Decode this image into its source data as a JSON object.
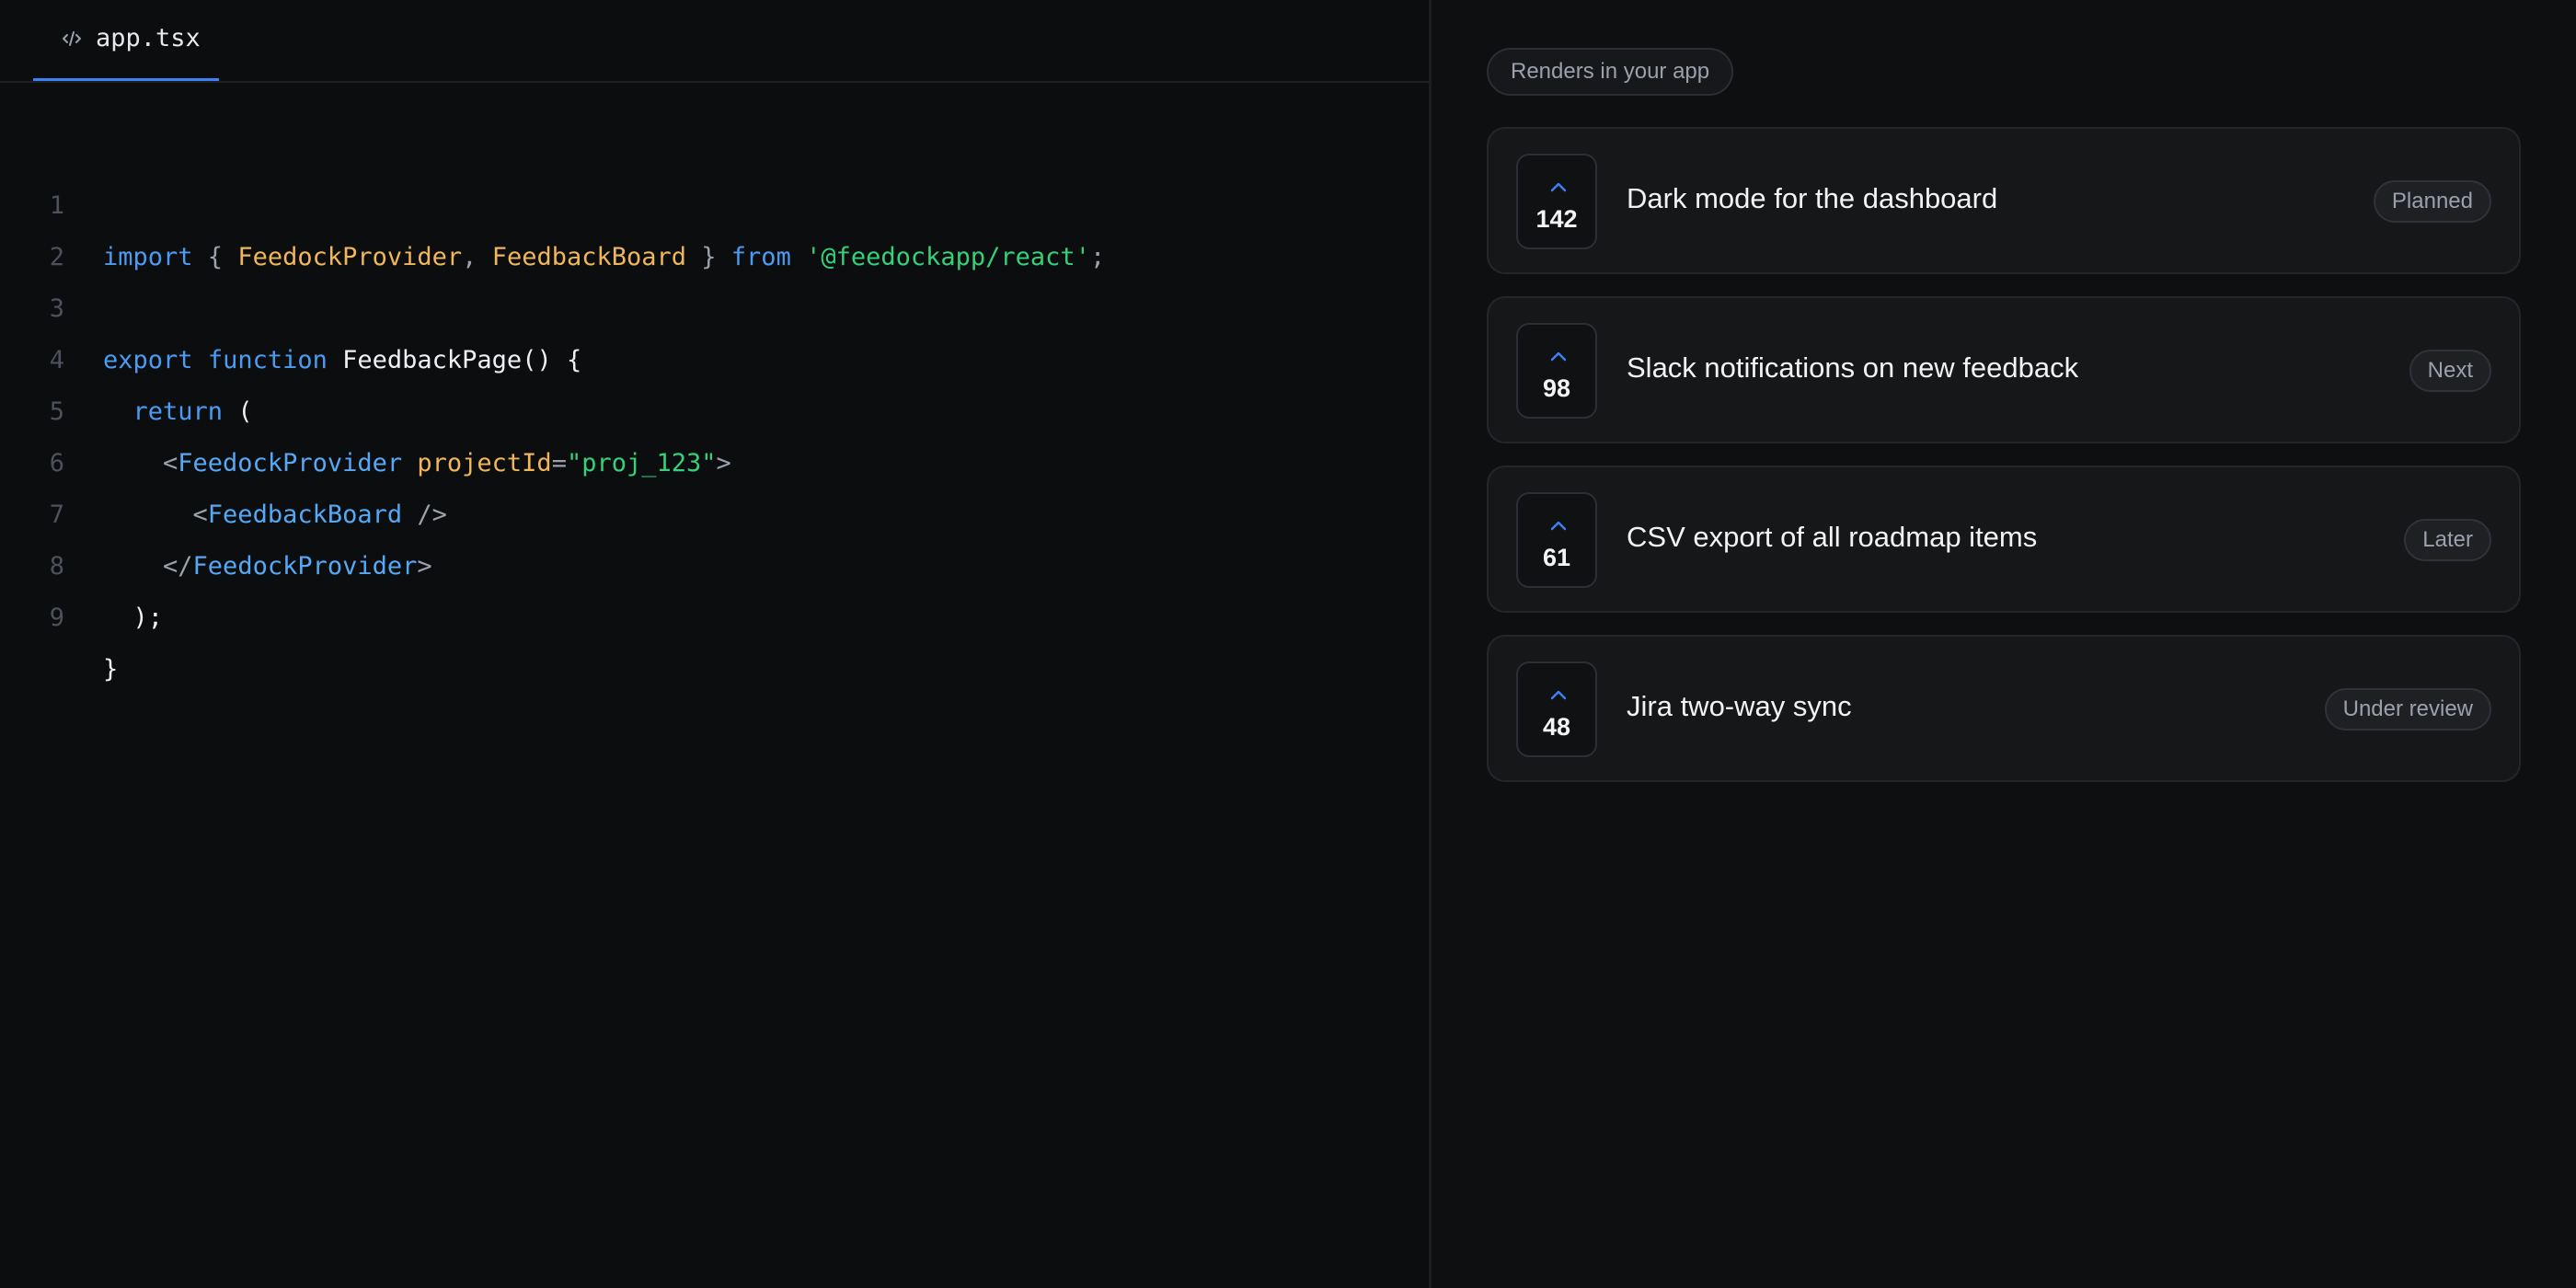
{
  "editor": {
    "tab": {
      "label": "app.tsx",
      "icon": "code-icon"
    },
    "line_numbers": [
      "1",
      "2",
      "3",
      "4",
      "5",
      "6",
      "7",
      "8",
      "9"
    ],
    "code_lines": [
      [
        {
          "t": "import",
          "c": "kw"
        },
        {
          "t": " { ",
          "c": "punc"
        },
        {
          "t": "FeedockProvider",
          "c": "id"
        },
        {
          "t": ", ",
          "c": "punc"
        },
        {
          "t": "FeedbackBoard",
          "c": "id"
        },
        {
          "t": " } ",
          "c": "punc"
        },
        {
          "t": "from",
          "c": "kw"
        },
        {
          "t": " ",
          "c": "punc"
        },
        {
          "t": "'@feedockapp/react'",
          "c": "str"
        },
        {
          "t": ";",
          "c": "punc"
        }
      ],
      [],
      [
        {
          "t": "export",
          "c": "kw"
        },
        {
          "t": " ",
          "c": "punc"
        },
        {
          "t": "function",
          "c": "kw"
        },
        {
          "t": " ",
          "c": "punc"
        },
        {
          "t": "FeedbackPage",
          "c": "fn"
        },
        {
          "t": "() {",
          "c": "fn"
        }
      ],
      [
        {
          "t": "  ",
          "c": "punc"
        },
        {
          "t": "return",
          "c": "kw"
        },
        {
          "t": " (",
          "c": "fn"
        }
      ],
      [
        {
          "t": "    <",
          "c": "punc"
        },
        {
          "t": "FeedockProvider",
          "c": "tag"
        },
        {
          "t": " ",
          "c": "punc"
        },
        {
          "t": "projectId",
          "c": "id"
        },
        {
          "t": "=",
          "c": "punc"
        },
        {
          "t": "\"proj_123\"",
          "c": "str"
        },
        {
          "t": ">",
          "c": "punc"
        }
      ],
      [
        {
          "t": "      <",
          "c": "punc"
        },
        {
          "t": "FeedbackBoard",
          "c": "tag"
        },
        {
          "t": " />",
          "c": "punc"
        }
      ],
      [
        {
          "t": "    </",
          "c": "punc"
        },
        {
          "t": "FeedockProvider",
          "c": "tag"
        },
        {
          "t": ">",
          "c": "punc"
        }
      ],
      [
        {
          "t": "  );",
          "c": "fn"
        }
      ],
      [
        {
          "t": "}",
          "c": "fn"
        }
      ]
    ]
  },
  "preview": {
    "badge": "Renders in your app",
    "items": [
      {
        "votes": "142",
        "title": "Dark mode for the dashboard",
        "status": "Planned"
      },
      {
        "votes": "98",
        "title": "Slack notifications on new feedback",
        "status": "Next"
      },
      {
        "votes": "61",
        "title": "CSV export of all roadmap items",
        "status": "Later"
      },
      {
        "votes": "48",
        "title": "Jira two-way sync",
        "status": "Under review"
      }
    ]
  },
  "colors": {
    "accent": "#3b82f6",
    "keyword": "#4a9cf2",
    "identifier": "#f0b65a",
    "string": "#34d07a",
    "background": "#0c0d0f"
  }
}
